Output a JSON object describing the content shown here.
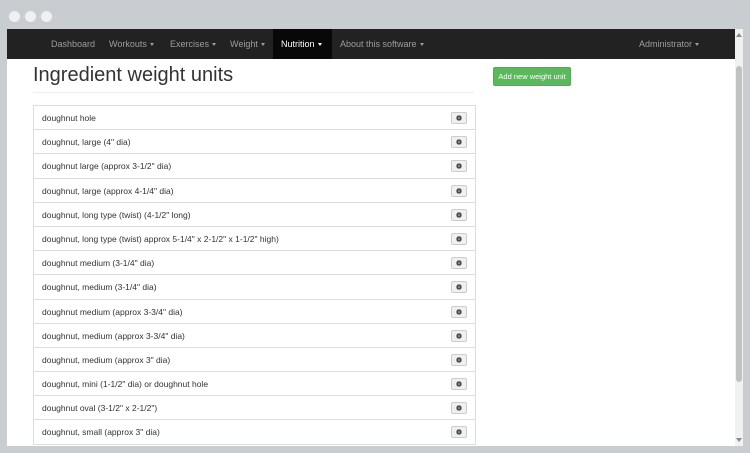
{
  "navbar": {
    "items": [
      {
        "label": "Dashboard",
        "has_caret": false
      },
      {
        "label": "Workouts",
        "has_caret": true
      },
      {
        "label": "Exercises",
        "has_caret": true
      },
      {
        "label": "Weight",
        "has_caret": true
      },
      {
        "label": "Nutrition",
        "has_caret": true,
        "active": true
      },
      {
        "label": "About this software",
        "has_caret": true
      }
    ],
    "user": {
      "label": "Administrator"
    }
  },
  "page": {
    "title": "Ingredient weight units",
    "add_button_label": "Add new weight unit"
  },
  "units": [
    "doughnut hole",
    "doughnut, large (4\" dia)",
    "doughnut large (approx 3-1/2\" dia)",
    "doughnut, large (approx 4-1/4\" dia)",
    "doughnut, long type (twist) (4-1/2\" long)",
    "doughnut, long type (twist) approx 5-1/4\" x 2-1/2\" x 1-1/2\" high)",
    "doughnut medium (3-1/4\" dia)",
    "doughnut, medium (3-1/4\" dia)",
    "doughnut medium (approx 3-3/4\" dia)",
    "doughnut, medium (approx 3-3/4\" dia)",
    "doughnut, medium (approx 3\" dia)",
    "doughnut, mini (1-1/2\" dia) or doughnut hole",
    "doughnut oval (3-1/2\" x 2-1/2\")",
    "doughnut, small (approx 3\" dia)"
  ],
  "icons": {
    "row_action": "gear-icon"
  },
  "colors": {
    "navbar": "#222222",
    "navbar_active": "#080808",
    "success": "#5cb85c"
  }
}
